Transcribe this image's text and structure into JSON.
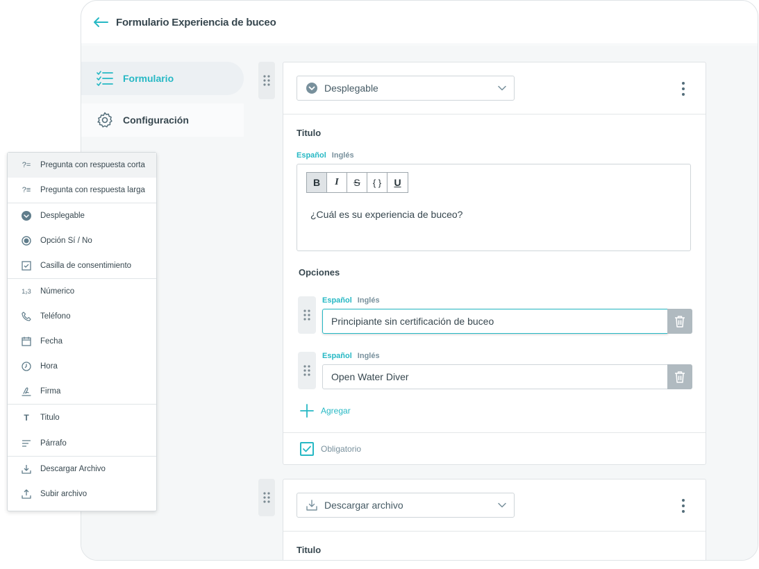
{
  "header": {
    "title": "Formulario Experiencia de buceo"
  },
  "sidebar": {
    "items": [
      {
        "label": "Formulario"
      },
      {
        "label": "Configuración"
      }
    ]
  },
  "card1": {
    "type_label": "Desplegable",
    "title_label": "Titulo",
    "lang_active": "Español",
    "lang_other": "Inglés",
    "toolbar": {
      "bold": "B",
      "italic": "I",
      "strike": "S",
      "code": "{ }",
      "underline": "U"
    },
    "question_text": "¿Cuál es su experiencia de buceo?",
    "options_label": "Opciones",
    "options": [
      {
        "value": "Principiante sin certificación de buceo"
      },
      {
        "value": "Open Water Diver"
      }
    ],
    "add_label": "Agregar",
    "required_label": "Obligatorio"
  },
  "card2": {
    "type_label": "Descargar archivo",
    "title_label": "Titulo"
  },
  "menu": {
    "items": [
      {
        "label": "Pregunta con respuesta corta",
        "icon": "short-answer-icon",
        "glyph": "?="
      },
      {
        "label": "Pregunta con respuesta larga",
        "icon": "long-answer-icon",
        "glyph": "?≡"
      },
      {
        "label": "Desplegable",
        "icon": "dropdown-icon",
        "glyph": ""
      },
      {
        "label": "Opción Sí / No",
        "icon": "radio-icon",
        "glyph": ""
      },
      {
        "label": "Casilla de consentimiento",
        "icon": "checkbox-icon",
        "glyph": ""
      },
      {
        "label": "Númerico",
        "icon": "numeric-icon",
        "glyph": "1₂3"
      },
      {
        "label": "Teléfono",
        "icon": "phone-icon",
        "glyph": ""
      },
      {
        "label": "Fecha",
        "icon": "calendar-icon",
        "glyph": ""
      },
      {
        "label": "Hora",
        "icon": "clock-icon",
        "glyph": ""
      },
      {
        "label": "Firma",
        "icon": "signature-icon",
        "glyph": ""
      },
      {
        "label": "Titulo",
        "icon": "title-icon",
        "glyph": "T"
      },
      {
        "label": "Párrafo",
        "icon": "paragraph-icon",
        "glyph": ""
      },
      {
        "label": "Descargar Archivo",
        "icon": "download-icon",
        "glyph": ""
      },
      {
        "label": "Subir archivo",
        "icon": "upload-icon",
        "glyph": ""
      }
    ]
  },
  "colors": {
    "accent": "#26b8c4",
    "text": "#37474f",
    "muted": "#78909c"
  }
}
